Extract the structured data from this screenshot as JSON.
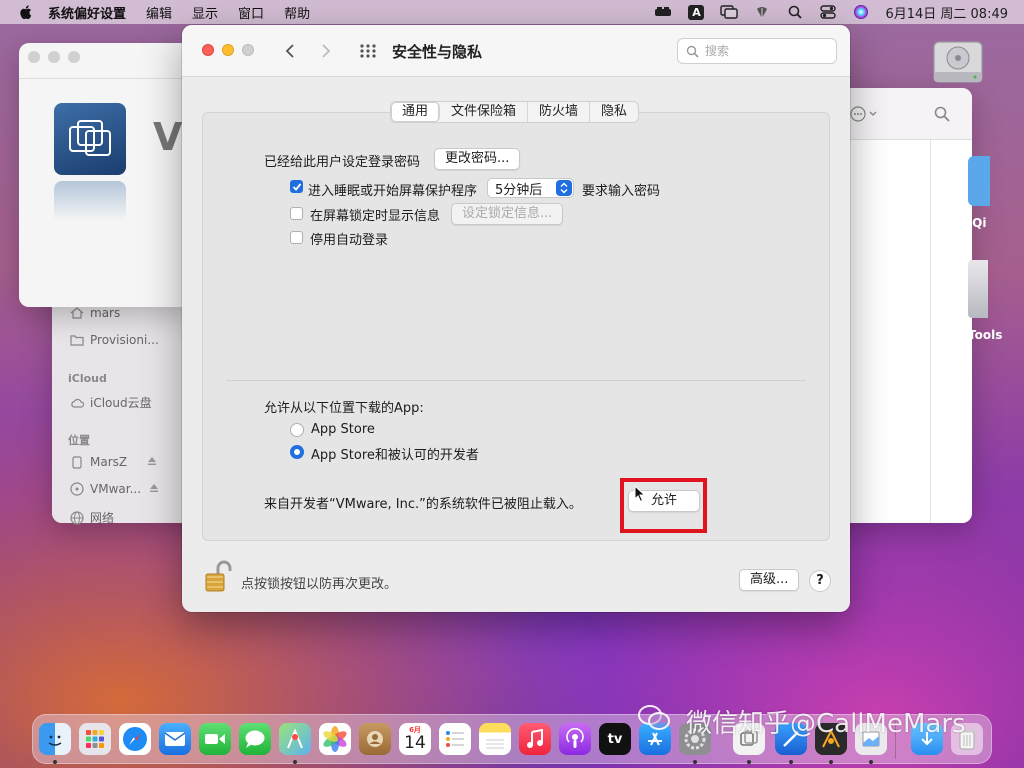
{
  "menubar": {
    "app_name": "系统偏好设置",
    "items": [
      "编辑",
      "显示",
      "窗口",
      "帮助"
    ],
    "clock": "6月14日 周二 08:49",
    "input_source": "A",
    "icons": [
      "vmware-tools-icon",
      "input-source-icon",
      "screen-mirroring-icon",
      "wifi-icon",
      "search-icon",
      "control-center-icon",
      "siri-icon"
    ]
  },
  "finder": {
    "sidebar": {
      "items_top": [
        "mars",
        "Provisioni..."
      ],
      "icloud_header": "iCloud",
      "icloud_items": [
        "iCloud云盘"
      ],
      "locations_header": "位置",
      "locations": [
        "MarsZ",
        "VMwar...",
        "网络"
      ]
    }
  },
  "vmware_window": {
    "title_initial": "V"
  },
  "desktop": {
    "labels": [
      "iQi",
      "Tools"
    ]
  },
  "prefs": {
    "title": "安全性与隐私",
    "search_placeholder": "搜索",
    "tabs": [
      "通用",
      "文件保险箱",
      "防火墙",
      "隐私"
    ],
    "active_tab": "通用",
    "password_label": "已经给此用户设定登录密码",
    "change_password_button": "更改密码...",
    "require_password": {
      "checked": true,
      "label_before": "进入睡眠或开始屏幕保护程序",
      "delay_value": "5分钟后",
      "label_after": "要求输入密码"
    },
    "lock_message": {
      "checked": false,
      "label": "在屏幕锁定时显示信息",
      "button": "设定锁定信息..."
    },
    "disable_autologin": {
      "checked": false,
      "label": "停用自动登录"
    },
    "download_header": "允许从以下位置下载的App:",
    "download_options": [
      "App Store",
      "App Store和被认可的开发者"
    ],
    "download_selected": 1,
    "blocked_message": "来自开发者“VMware, Inc.”的系统软件已被阻止载入。",
    "allow_button": "允许",
    "lock_text": "点按锁按钮以防再次更改。",
    "advanced_button": "高级...",
    "help_button": "?"
  },
  "dock": {
    "calendar_month": "6月",
    "calendar_day": "14",
    "tv_label": "tv",
    "apps": [
      "finder",
      "launchpad",
      "safari",
      "mail",
      "facetime",
      "messages",
      "maps",
      "photos",
      "contacts",
      "calendar",
      "reminders",
      "notes",
      "music",
      "podcasts",
      "tv",
      "app-store",
      "system-preferences",
      "vmware-fusion",
      "xcode",
      "instruments",
      "preview",
      "downloads",
      "trash"
    ]
  },
  "watermark": "微信知乎@CallMeMars",
  "colors": {
    "accent": "#1f6fe0",
    "highlight_box": "#e0141e",
    "traffic_red": "#fe5f57",
    "traffic_yellow": "#febc2e"
  }
}
